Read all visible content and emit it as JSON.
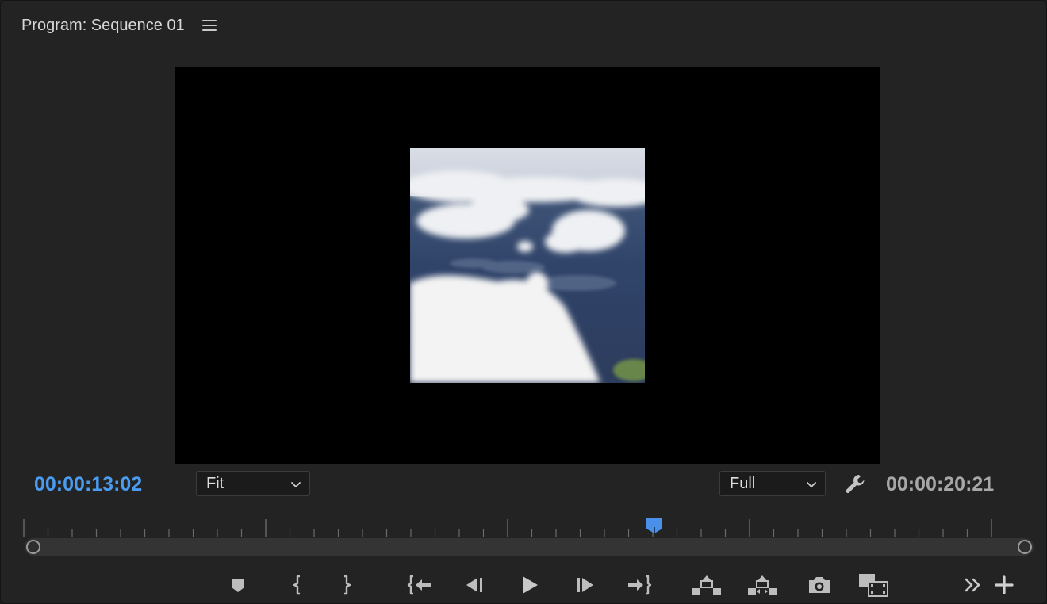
{
  "panel": {
    "title": "Program: Sequence 01",
    "menu_icon": "hamburger-menu-icon"
  },
  "timecode": {
    "current": "00:00:13:02",
    "duration": "00:00:20:21"
  },
  "zoom_dropdown": {
    "value": "Fit"
  },
  "resolution_dropdown": {
    "value": "Full"
  },
  "playhead": {
    "position_fraction": 0.637
  },
  "transport": {
    "buttons": [
      "add-marker-icon",
      "mark-in-icon",
      "mark-out-icon",
      "go-to-in-icon",
      "step-back-icon",
      "play-icon",
      "step-forward-icon",
      "go-to-out-icon",
      "lift-icon",
      "extract-icon",
      "export-frame-icon",
      "comparison-view-icon",
      "more-controls-icon",
      "button-editor-icon"
    ]
  },
  "colors": {
    "accent": "#4a9cf0",
    "panel_bg": "#232323",
    "monitor_bg": "#000000"
  }
}
